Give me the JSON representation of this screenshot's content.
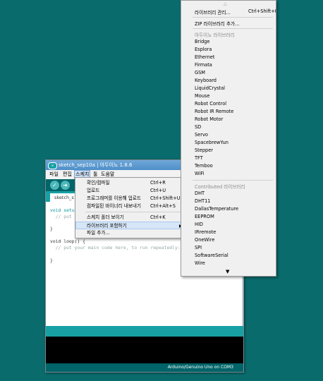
{
  "window": {
    "logo": "∞",
    "title": "sketch_sep10a | 아두이노 1.8.6"
  },
  "menubar": {
    "file": "파일",
    "edit": "편집",
    "sketch": "스케치",
    "tools": "툴",
    "help": "도움말"
  },
  "toolbar": {
    "verify_icon": "checkmark-icon",
    "upload_icon": "arrow-right-icon"
  },
  "tab": {
    "label": "sketch_s"
  },
  "editor": {
    "lines": [
      "void setup",
      "  // put y",
      "}",
      "void loop() {",
      "  // put your main code here, to run repeatedly:",
      "}"
    ]
  },
  "status": {
    "board": "Arduino/Genuino Uno on COM3"
  },
  "sketch_menu": {
    "items": [
      {
        "label": "확인/컴파일",
        "shortcut": "Ctrl+R"
      },
      {
        "label": "업로드",
        "shortcut": "Ctrl+U"
      },
      {
        "label": "프로그래머를 이용해 업로드",
        "shortcut": "Ctrl+Shift+U"
      },
      {
        "label": "컴파일된 바이너리 내보내기",
        "shortcut": "Ctrl+Alt+S"
      },
      {
        "label": "스케치 폴더 보이기",
        "shortcut": "Ctrl+K"
      },
      {
        "label": "라이브러리 포함하기",
        "shortcut": ""
      },
      {
        "label": "파일 추가...",
        "shortcut": ""
      }
    ]
  },
  "library_menu": {
    "manage": {
      "label": "라이브러리 관리...",
      "shortcut": "Ctrl+Shift+I"
    },
    "add_zip": "ZIP 라이브러리 추가...",
    "arduino_header": "아두이노 라이브러리",
    "arduino_libs": [
      "Bridge",
      "Esplora",
      "Ethernet",
      "Firmata",
      "GSM",
      "Keyboard",
      "LiquidCrystal",
      "Mouse",
      "Robot Control",
      "Robot IR Remote",
      "Robot Motor",
      "SD",
      "Servo",
      "SpacebrewYun",
      "Stepper",
      "TFT",
      "Temboo",
      "WiFi"
    ],
    "contributed_header": "Contributed 라이브러리",
    "contributed_libs": [
      "DHT",
      "DHT11",
      "DallasTemperature",
      "EEPROM",
      "HID",
      "IRremote",
      "OneWire",
      "SPI",
      "SoftwareSerial",
      "Wire"
    ]
  }
}
